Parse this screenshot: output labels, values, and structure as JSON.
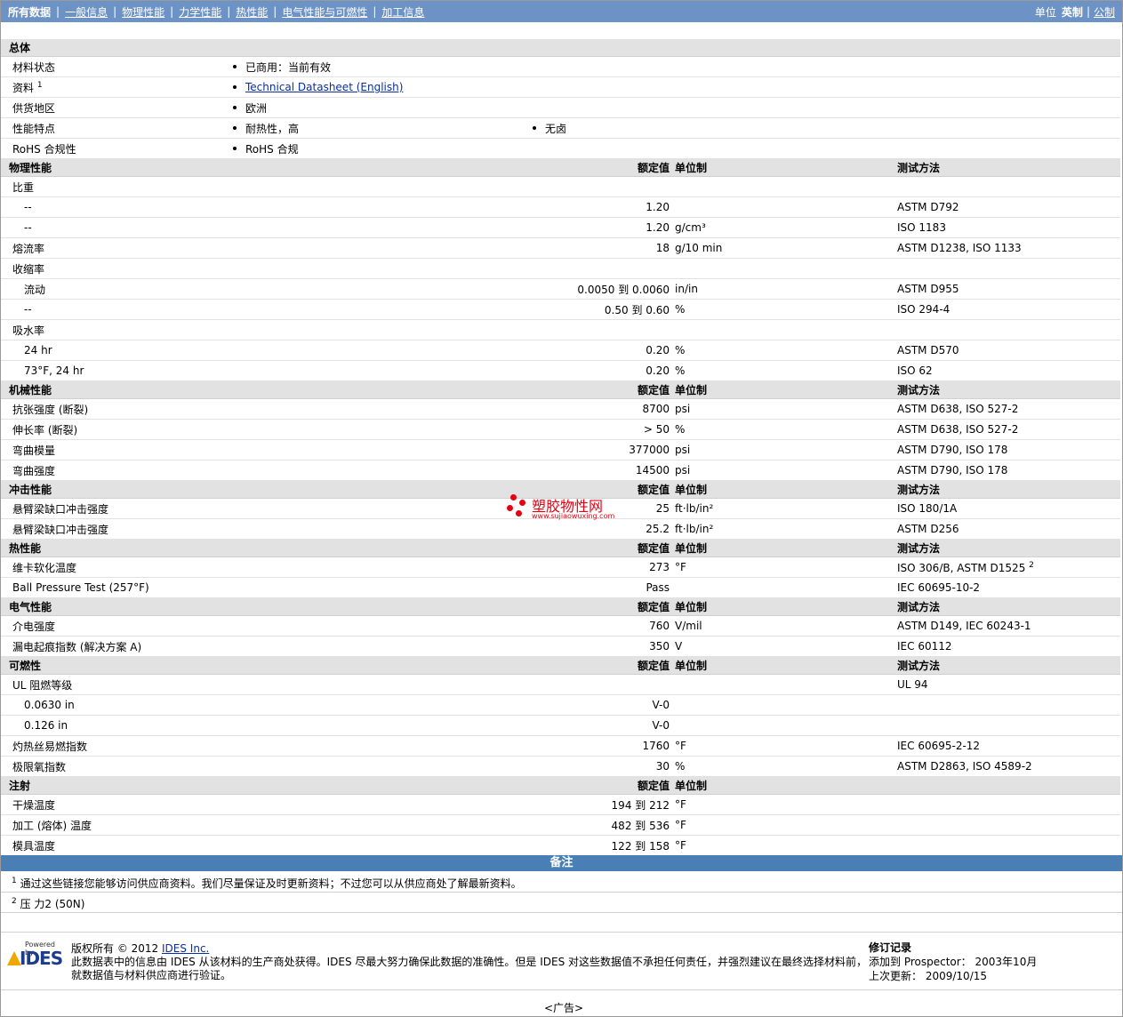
{
  "nav": {
    "tabs": [
      "所有数据",
      "一般信息",
      "物理性能",
      "力学性能",
      "热性能",
      "电气性能与可燃性",
      "加工信息"
    ],
    "units_label": "单位",
    "unit_english": "英制",
    "unit_metric": "公制"
  },
  "general": {
    "title": "总体",
    "status_label": "材料状态",
    "status_value": "已商用：当前有效",
    "docs_label": "资料",
    "docs_sup": "1",
    "docs_link": "Technical Datasheet (English)",
    "region_label": "供货地区",
    "region_value": "欧洲",
    "features_label": "性能特点",
    "feature_1": "耐热性，高",
    "feature_2": "无卤",
    "rohs_label": "RoHS 合规性",
    "rohs_value": "RoHS 合规"
  },
  "col": {
    "nominal": "额定值",
    "unit": "单位制",
    "method": "测试方法"
  },
  "physical": {
    "title": "物理性能",
    "sg_label": "比重",
    "sg_rows": [
      {
        "label": "--",
        "value": "1.20",
        "unit": "",
        "method": "ASTM D792"
      },
      {
        "label": "--",
        "value": "1.20",
        "unit": "g/cm³",
        "method": "ISO 1183"
      }
    ],
    "mfr": {
      "label": "熔流率",
      "value": "18",
      "unit": "g/10 min",
      "method": "ASTM D1238, ISO 1133"
    },
    "shrink_label": "收缩率",
    "shrink_rows": [
      {
        "label": "流动",
        "value": "0.0050 到  0.0060",
        "unit": "in/in",
        "method": "ASTM D955"
      },
      {
        "label": "--",
        "value": "0.50 到  0.60",
        "unit": "%",
        "method": "ISO 294-4"
      }
    ],
    "abs_label": "吸水率",
    "abs_rows": [
      {
        "label": "24 hr",
        "value": "0.20",
        "unit": "%",
        "method": "ASTM D570"
      },
      {
        "label": "73°F, 24 hr",
        "value": "0.20",
        "unit": "%",
        "method": "ISO 62"
      }
    ]
  },
  "mechanical": {
    "title": "机械性能",
    "rows": [
      {
        "label": "抗张强度 (断裂)",
        "value": "8700",
        "unit": "psi",
        "method": "ASTM D638, ISO 527-2"
      },
      {
        "label": "伸长率 (断裂)",
        "value": "> 50",
        "unit": "%",
        "method": "ASTM D638, ISO 527-2"
      },
      {
        "label": "弯曲模量",
        "value": "377000",
        "unit": "psi",
        "method": "ASTM D790, ISO 178"
      },
      {
        "label": "弯曲强度",
        "value": "14500",
        "unit": "psi",
        "method": "ASTM D790, ISO 178"
      }
    ]
  },
  "impact": {
    "title": "冲击性能",
    "rows": [
      {
        "label": "悬臂梁缺口冲击强度",
        "value": "25",
        "unit": "ft·lb/in²",
        "method": "ISO 180/1A"
      },
      {
        "label": "悬臂梁缺口冲击强度",
        "value": "25.2",
        "unit": "ft·lb/in²",
        "method": "ASTM D256"
      }
    ]
  },
  "thermal": {
    "title": "热性能",
    "vicat": {
      "label": "维卡软化温度",
      "value": "273",
      "unit": "°F",
      "method": "ISO 306/B, ASTM D1525",
      "sup": "2"
    },
    "ball": {
      "label": "Ball Pressure Test (257°F)",
      "value": "Pass",
      "unit": "",
      "method": "IEC 60695-10-2"
    }
  },
  "electrical": {
    "title": "电气性能",
    "rows": [
      {
        "label": "介电强度",
        "value": "760",
        "unit": "V/mil",
        "method": "ASTM D149, IEC 60243-1"
      },
      {
        "label": "漏电起痕指数 (解决方案 A)",
        "value": "350",
        "unit": "V",
        "method": "IEC 60112"
      }
    ]
  },
  "flammability": {
    "title": "可燃性",
    "ul_label": "UL 阻燃等级",
    "ul_method": "UL 94",
    "ul_rows": [
      {
        "label": "0.0630 in",
        "value": "V-0"
      },
      {
        "label": "0.126 in",
        "value": "V-0"
      }
    ],
    "rows": [
      {
        "label": "灼热丝易燃指数",
        "value": "1760",
        "unit": "°F",
        "method": "IEC 60695-2-12"
      },
      {
        "label": "极限氧指数",
        "value": "30",
        "unit": "%",
        "method": "ASTM D2863, ISO 4589-2"
      }
    ]
  },
  "injection": {
    "title": "注射",
    "rows": [
      {
        "label": "干燥温度",
        "value": "194 到  212",
        "unit": "°F"
      },
      {
        "label": "加工 (熔体) 温度",
        "value": "482 到  536",
        "unit": "°F"
      },
      {
        "label": "模具温度",
        "value": "122 到  158",
        "unit": "°F"
      }
    ]
  },
  "notes": {
    "title": "备注",
    "n1_sup": "1",
    "n1": "通过这些链接您能够访问供应商资料。我们尽量保证及时更新资料；不过您可以从供应商处了解最新资料。",
    "n2_sup": "2",
    "n2": "压 力2 (50N)"
  },
  "footer": {
    "powered": "Powered by",
    "ides": "IDES",
    "copyright": "版权所有 © 2012",
    "company": "IDES Inc.",
    "disclaimer1": "此数据表中的信息由 IDES 从该材料的生产商处获得。IDES 尽最大努力确保此数据的准确性。但是 IDES 对这些数据值不承担任何责任，并强烈建议在最终选择材料前，",
    "disclaimer2": "就数据值与材料供应商进行验证。",
    "rev_title": "修订记录",
    "added_label": "添加到 Prospector：",
    "added_value": "2003年10月",
    "updated_label": "上次更新：",
    "updated_value": "2009/10/15",
    "ad": "<广告>"
  },
  "watermark": {
    "cn": "塑胶物性网",
    "url": "www.sujiaowuxing.com"
  }
}
